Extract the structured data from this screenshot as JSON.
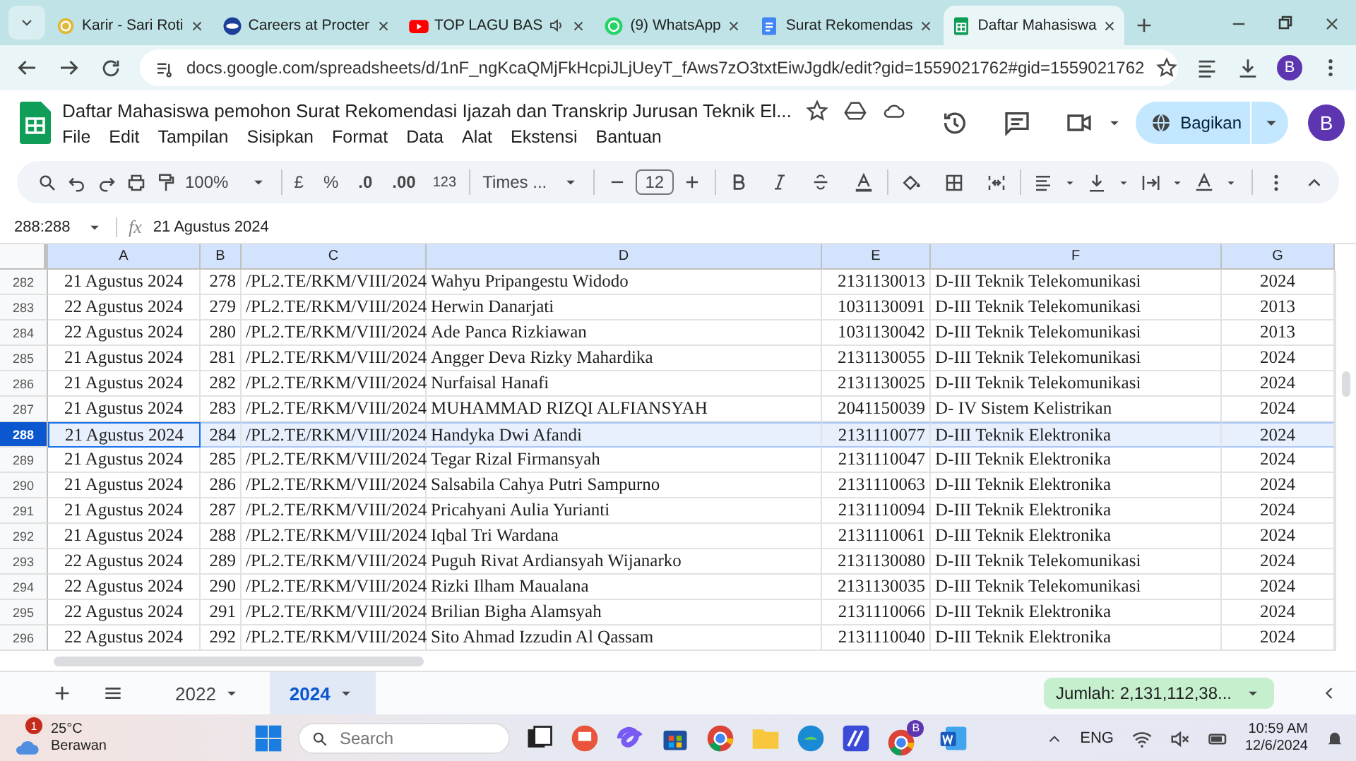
{
  "browser": {
    "tabs": [
      {
        "title": "Karir - Sari Roti",
        "selected": false
      },
      {
        "title": "Careers at Procter",
        "selected": false
      },
      {
        "title": "TOP LAGU BAS",
        "selected": false
      },
      {
        "title": "(9) WhatsApp",
        "selected": false
      },
      {
        "title": "Surat Rekomendas",
        "selected": false
      },
      {
        "title": "Daftar Mahasiswa",
        "selected": true
      }
    ],
    "url": "docs.google.com/spreadsheets/d/1nF_ngKcaQMjFkHcpiJLjUeyT_fAws7zO3txtEiwJgdk/edit?gid=1559021762#gid=1559021762",
    "profile": "B"
  },
  "doc": {
    "title": "Daftar Mahasiswa pemohon Surat Rekomendasi Ijazah dan Transkrip Jurusan Teknik El...",
    "menus": [
      "File",
      "Edit",
      "Tampilan",
      "Sisipkan",
      "Format",
      "Data",
      "Alat",
      "Ekstensi",
      "Bantuan"
    ],
    "share": "Bagikan",
    "avatar": "B"
  },
  "toolbar": {
    "zoom": "100%",
    "currency": "£",
    "percent": "%",
    "dec_less": ".0",
    "dec_more": ".00",
    "number_format": "123",
    "font": "Times ...",
    "font_size": "12"
  },
  "formula_bar": {
    "name_box": "288:288",
    "fx": "fx",
    "value": "21 Agustus 2024"
  },
  "columns": [
    "A",
    "B",
    "C",
    "D",
    "E",
    "F",
    "G"
  ],
  "rows": [
    {
      "number": "282",
      "selected": false,
      "cells": [
        "21 Agustus 2024",
        "278",
        "/PL2.TE/RKM/VIII/2024",
        "Wahyu Pripangestu Widodo",
        "2131130013",
        "D-III Teknik Telekomunikasi",
        "2024"
      ]
    },
    {
      "number": "283",
      "selected": false,
      "cells": [
        "22 Agustus 2024",
        "279",
        "/PL2.TE/RKM/VIII/2024",
        "Herwin Danarjati",
        "1031130091",
        "D-III Teknik Telekomunikasi",
        "2013"
      ]
    },
    {
      "number": "284",
      "selected": false,
      "cells": [
        "22 Agustus 2024",
        "280",
        "/PL2.TE/RKM/VIII/2024",
        "Ade Panca Rizkiawan",
        "1031130042",
        "D-III Teknik Telekomunikasi",
        "2013"
      ]
    },
    {
      "number": "285",
      "selected": false,
      "cells": [
        "21 Agustus 2024",
        "281",
        "/PL2.TE/RKM/VIII/2024",
        "Angger Deva Rizky Mahardika",
        "2131130055",
        "D-III Teknik Telekomunikasi",
        "2024"
      ]
    },
    {
      "number": "286",
      "selected": false,
      "cells": [
        "21 Agustus 2024",
        "282",
        "/PL2.TE/RKM/VIII/2024",
        "Nurfaisal Hanafi",
        "2131130025",
        "D-III Teknik Telekomunikasi",
        "2024"
      ]
    },
    {
      "number": "287",
      "selected": false,
      "cells": [
        "21 Agustus 2024",
        "283",
        "/PL2.TE/RKM/VIII/2024",
        "MUHAMMAD RIZQI ALFIANSYAH",
        "2041150039",
        "D- IV Sistem Kelistrikan",
        "2024"
      ]
    },
    {
      "number": "288",
      "selected": true,
      "cells": [
        "21 Agustus 2024",
        "284",
        "/PL2.TE/RKM/VIII/2024",
        "Handyka Dwi Afandi",
        "2131110077",
        "D-III Teknik Elektronika",
        "2024"
      ]
    },
    {
      "number": "289",
      "selected": false,
      "cells": [
        "21 Agustus 2024",
        "285",
        "/PL2.TE/RKM/VIII/2024",
        "Tegar Rizal Firmansyah",
        "2131110047",
        "D-III Teknik Elektronika",
        "2024"
      ]
    },
    {
      "number": "290",
      "selected": false,
      "cells": [
        "21 Agustus 2024",
        "286",
        "/PL2.TE/RKM/VIII/2024",
        "Salsabila Cahya Putri Sampurno",
        "2131110063",
        "D-III Teknik Elektronika",
        "2024"
      ]
    },
    {
      "number": "291",
      "selected": false,
      "cells": [
        "21 Agustus 2024",
        "287",
        "/PL2.TE/RKM/VIII/2024",
        "Pricahyani Aulia Yurianti",
        "2131110094",
        "D-III Teknik Elektronika",
        "2024"
      ]
    },
    {
      "number": "292",
      "selected": false,
      "cells": [
        "21 Agustus 2024",
        "288",
        "/PL2.TE/RKM/VIII/2024",
        "Iqbal Tri Wardana",
        "2131110061",
        "D-III Teknik Elektronika",
        "2024"
      ]
    },
    {
      "number": "293",
      "selected": false,
      "cells": [
        "22 Agustus 2024",
        "289",
        "/PL2.TE/RKM/VIII/2024",
        "Puguh Rivat Ardiansyah Wijanarko",
        "2131130080",
        "D-III Teknik Telekomunikasi",
        "2024"
      ]
    },
    {
      "number": "294",
      "selected": false,
      "cells": [
        "22 Agustus 2024",
        "290",
        "/PL2.TE/RKM/VIII/2024",
        "Rizki Ilham Maualana",
        "2131130035",
        "D-III Teknik Telekomunikasi",
        "2024"
      ]
    },
    {
      "number": "295",
      "selected": false,
      "cells": [
        "22 Agustus 2024",
        "291",
        "/PL2.TE/RKM/VIII/2024",
        "Brilian Bigha Alamsyah",
        "2131110066",
        "D-III Teknik Elektronika",
        "2024"
      ]
    },
    {
      "number": "296",
      "selected": false,
      "cells": [
        "22 Agustus 2024",
        "292",
        "/PL2.TE/RKM/VIII/2024",
        "Sito Ahmad Izzudin Al Qassam",
        "2131110040",
        "D-III Teknik Elektronika",
        "2024"
      ]
    }
  ],
  "sheets": [
    {
      "name": "2022",
      "selected": false
    },
    {
      "name": "2024",
      "selected": true
    }
  ],
  "sum": "Jumlah: 2,131,112,38...",
  "taskbar": {
    "badge": "1",
    "temperature": "25°C",
    "weather": "Berawan",
    "search": {
      "placeholder": "Search"
    },
    "app_badge": "B",
    "language": "ENG",
    "time": "10:59 AM",
    "date": "12/6/2024"
  }
}
